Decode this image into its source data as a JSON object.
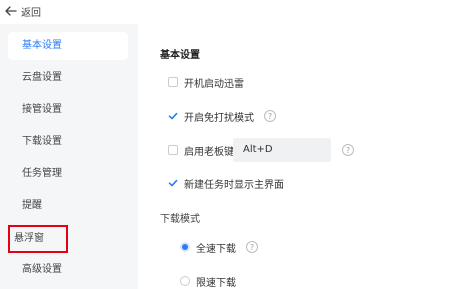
{
  "topbar": {
    "back_label": "返回"
  },
  "sidebar": {
    "items": [
      {
        "label": "基本设置"
      },
      {
        "label": "云盘设置"
      },
      {
        "label": "接管设置"
      },
      {
        "label": "下载设置"
      },
      {
        "label": "任务管理"
      },
      {
        "label": "提醒"
      },
      {
        "label": "悬浮窗"
      },
      {
        "label": "高级设置"
      }
    ],
    "active_index": 0,
    "highlighted_index": 6
  },
  "panel": {
    "section_title": "基本设置",
    "options": {
      "autostart": {
        "label": "开机启动迅雷",
        "checked": false
      },
      "no_disturb": {
        "label": "开启免打扰模式",
        "checked": true
      },
      "boss_key": {
        "label": "启用老板键",
        "checked": false,
        "value": "Alt+D"
      },
      "show_main": {
        "label": "新建任务时显示主界面",
        "checked": true
      }
    },
    "download_mode": {
      "title": "下载模式",
      "full_speed": {
        "label": "全速下载",
        "selected": true
      },
      "limited": {
        "label": "限速下载",
        "selected": false
      }
    },
    "help_glyph": "?"
  },
  "colors": {
    "accent": "#2b7cf6",
    "highlight_border": "#e60012"
  },
  "icons": {
    "back": "arrow-left-icon",
    "check": "check-icon",
    "help": "question-circle-icon"
  }
}
